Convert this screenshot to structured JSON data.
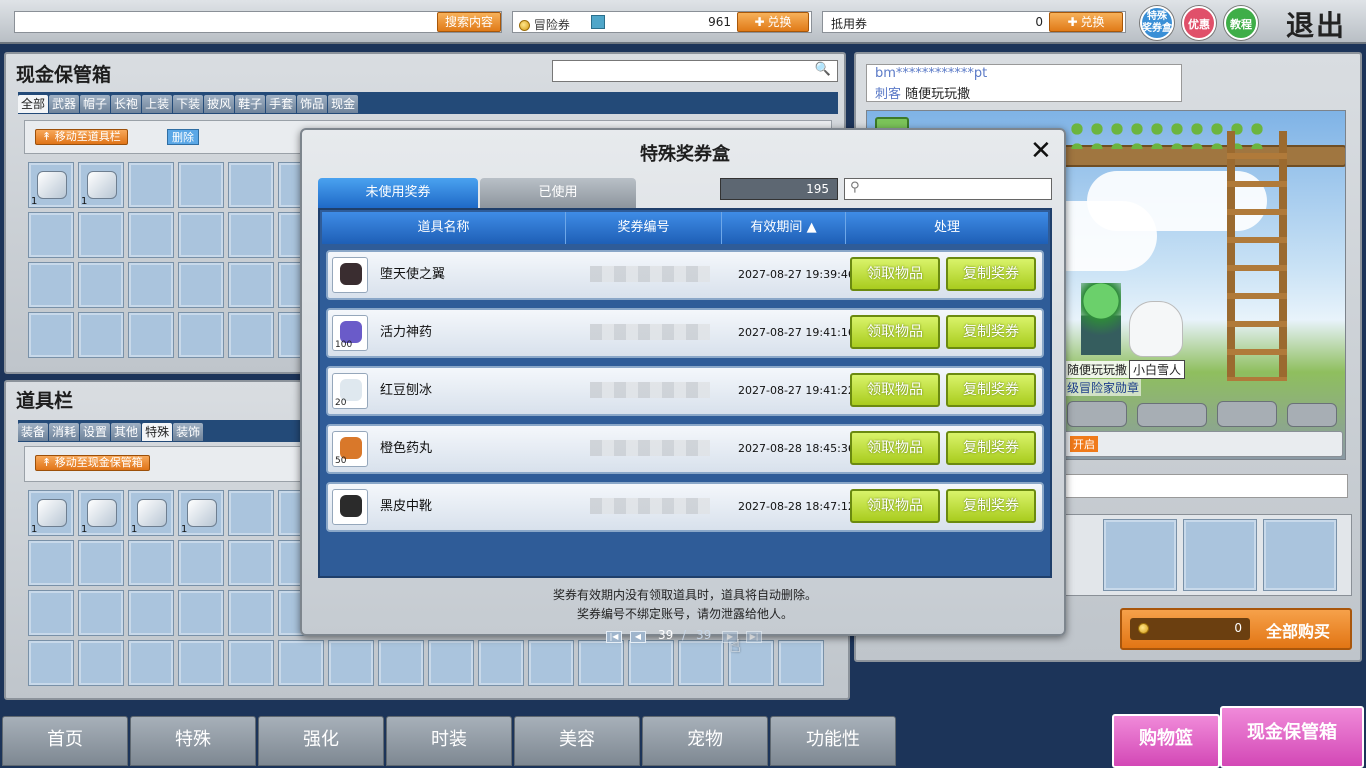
{
  "topbar": {
    "search_label": "搜索内容",
    "maple_label": "冒险券",
    "maple_value": "961",
    "exchange1": "兑换",
    "voucher_label": "抵用券",
    "voucher_value": "0",
    "exchange2": "兑换",
    "btn_special": "特殊奖券盒",
    "btn_special_top": "特殊",
    "btn_special_bottom": "奖券盒",
    "btn_coupon": "优惠券",
    "btn_tutorial": "教程",
    "exit": "退出"
  },
  "cash_locker": {
    "title": "现金保管箱",
    "tabs": [
      "全部",
      "武器",
      "帽子",
      "长袍",
      "上装",
      "下装",
      "披风",
      "鞋子",
      "手套",
      "饰品",
      "现金"
    ],
    "move_btn": "移动至道具栏",
    "delete_btn": "删除",
    "qty1": "1",
    "qty2": "1"
  },
  "inventory": {
    "title": "道具栏",
    "tabs": [
      "装备",
      "消耗",
      "设置",
      "其他",
      "特殊",
      "装饰"
    ],
    "move_btn": "移动至现金保管箱",
    "qtys": [
      "1",
      "1",
      "1",
      "1"
    ]
  },
  "right_panel": {
    "account": "bm************pt",
    "job": "刺客",
    "char_name": "随便玩玩撒",
    "char_tag": "随便玩玩撒",
    "pet_tag": "小白雪人",
    "medal": "级冒险家勋章",
    "open_label": "开启",
    "total_value": "0",
    "buy_all": "全部购买"
  },
  "modal": {
    "title": "特殊奖券盒",
    "tab_unused": "未使用奖券",
    "tab_used": "已使用",
    "count": "195",
    "search_placeholder": "",
    "headers": [
      "道具名称",
      "奖券编号",
      "有效期间",
      "处理"
    ],
    "rows": [
      {
        "name": "堕天使之翼",
        "date": "2027-08-27 19:39:46",
        "qty": "",
        "claim": "领取物品",
        "copy": "复制奖券"
      },
      {
        "name": "活力神药",
        "date": "2027-08-27 19:41:16",
        "qty": "100",
        "claim": "领取物品",
        "copy": "复制奖券"
      },
      {
        "name": "红豆刨冰",
        "date": "2027-08-27 19:41:22",
        "qty": "20",
        "claim": "领取物品",
        "copy": "复制奖券"
      },
      {
        "name": "橙色药丸",
        "date": "2027-08-28 18:45:36",
        "qty": "50",
        "claim": "领取物品",
        "copy": "复制奖券"
      },
      {
        "name": "黑皮中靴",
        "date": "2027-08-28 18:47:12",
        "qty": "",
        "claim": "领取物品",
        "copy": "复制奖券"
      }
    ],
    "page_current": "39",
    "page_sep": "/",
    "page_total": "39",
    "notice1": "奖券有效期内没有领取道具时，道具将自动删除。",
    "notice2": "奖券编号不绑定账号，请勿泄露给他人。"
  },
  "nav": {
    "tabs": [
      "首页",
      "特殊",
      "强化",
      "时装",
      "美容",
      "宠物",
      "功能性"
    ],
    "cart": "购物篮",
    "locker": "现金保管箱"
  },
  "colors": {
    "accent": "#1e5fb6",
    "orange": "#e07a18",
    "green": "#a9cc1e",
    "pink": "#d348b6"
  }
}
